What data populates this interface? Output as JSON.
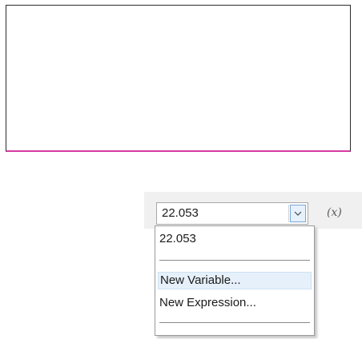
{
  "combo": {
    "value": "22.053",
    "arrow_icon": "chevron-down-icon"
  },
  "fx_label": "(x)",
  "dropdown": {
    "items": [
      {
        "label": "22.053"
      },
      {
        "label": "New Variable..."
      },
      {
        "label": "New Expression..."
      }
    ],
    "highlighted": "New Variable..."
  },
  "colors": {
    "canvas_bottom_border": "#d63aa0",
    "arrow_button_border": "#7aa7d9",
    "highlight_bg": "#e6f0fa"
  }
}
